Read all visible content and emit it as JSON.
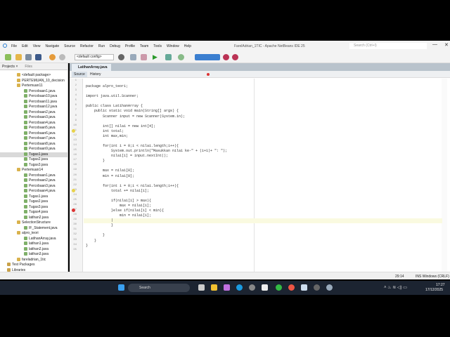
{
  "window": {
    "title": "FarelAdrian_1TIC - Apache NetBeans IDE 25",
    "search_placeholder": "Search (Ctrl+I)",
    "minimize": "—",
    "maximize": "❐",
    "close": "✕"
  },
  "menu": [
    "File",
    "Edit",
    "View",
    "Navigate",
    "Source",
    "Refactor",
    "Run",
    "Debug",
    "Profile",
    "Team",
    "Tools",
    "Window",
    "Help"
  ],
  "toolbar": {
    "config": "<default config>"
  },
  "projects_panel": {
    "tabs": [
      "Projects ×",
      "Files"
    ],
    "tree": [
      {
        "label": "<default package>",
        "level": 2,
        "type": "pkg"
      },
      {
        "label": "PERTEMUAN_10_decision",
        "level": 2,
        "type": "pkg"
      },
      {
        "label": "Pertemuan11",
        "level": 2,
        "type": "pkg"
      },
      {
        "label": "Percobaan1.java",
        "level": 3,
        "type": "java"
      },
      {
        "label": "Percobaan10.java",
        "level": 3,
        "type": "java"
      },
      {
        "label": "Percobaan11.java",
        "level": 3,
        "type": "java"
      },
      {
        "label": "Percobaan12.java",
        "level": 3,
        "type": "java"
      },
      {
        "label": "Percobaan2.java",
        "level": 3,
        "type": "java"
      },
      {
        "label": "Percobaan3.java",
        "level": 3,
        "type": "java"
      },
      {
        "label": "Percobaan4.java",
        "level": 3,
        "type": "java"
      },
      {
        "label": "Percobaan5.java",
        "level": 3,
        "type": "java"
      },
      {
        "label": "Percobaan6.java",
        "level": 3,
        "type": "java"
      },
      {
        "label": "Percobaan7.java",
        "level": 3,
        "type": "java"
      },
      {
        "label": "Percobaan8.java",
        "level": 3,
        "type": "java"
      },
      {
        "label": "Percobaan9.java",
        "level": 3,
        "type": "java"
      },
      {
        "label": "Tugas1.java",
        "level": 3,
        "type": "java",
        "selected": true
      },
      {
        "label": "Tugas2.java",
        "level": 3,
        "type": "java"
      },
      {
        "label": "Tugas3.java",
        "level": 3,
        "type": "java"
      },
      {
        "label": "Pertemuan14",
        "level": 2,
        "type": "pkg"
      },
      {
        "label": "Percobaan1.java",
        "level": 3,
        "type": "java"
      },
      {
        "label": "Percobaan2.java",
        "level": 3,
        "type": "java"
      },
      {
        "label": "Percobaan3.java",
        "level": 3,
        "type": "java"
      },
      {
        "label": "Percobaan4.java",
        "level": 3,
        "type": "java"
      },
      {
        "label": "Tugas1.java",
        "level": 3,
        "type": "java"
      },
      {
        "label": "Tugas2.java",
        "level": 3,
        "type": "java"
      },
      {
        "label": "Tugas3.java",
        "level": 3,
        "type": "java"
      },
      {
        "label": "Tugas4.java",
        "level": 3,
        "type": "java"
      },
      {
        "label": "latihan2.java",
        "level": 3,
        "type": "java"
      },
      {
        "label": "SelectionStructure",
        "level": 2,
        "type": "pkg"
      },
      {
        "label": "IF_Statement.java",
        "level": 3,
        "type": "java"
      },
      {
        "label": "alpro_teori",
        "level": 2,
        "type": "pkg"
      },
      {
        "label": "LatihanArray.java",
        "level": 3,
        "type": "java"
      },
      {
        "label": "latihan1.java",
        "level": 3,
        "type": "java"
      },
      {
        "label": "latihan2.java",
        "level": 3,
        "type": "java"
      },
      {
        "label": "latihan3.java",
        "level": 3,
        "type": "java"
      },
      {
        "label": "fareladrian_1tic",
        "level": 2,
        "type": "pkg"
      },
      {
        "label": "Test Packages",
        "level": 1,
        "type": "folder"
      },
      {
        "label": "Libraries",
        "level": 1,
        "type": "folder"
      }
    ]
  },
  "editor": {
    "tab": "LatihanArray.java",
    "source_tab": "Source",
    "history_tab": "History",
    "lines": [
      "",
      "package alpro_teori;",
      "",
      "import java.util.Scanner;",
      "",
      "public class LatihanArray {",
      "    public static void main(String[] args) {",
      "        Scanner input = new Scanner(System.in);",
      "",
      "        int[] nilai = new int[4];",
      "        int total;",
      "        int max,min;",
      "",
      "        for(int i = 0;i < nilai.length;i++){",
      "            System.out.println(\"Masukkan nilai ke-\" + (i+1)+ \": \");",
      "            nilai[i] = input.nextInt();",
      "        }",
      "",
      "        max = nilai[0];",
      "        min = nilai[0];",
      "",
      "        for(int i = 0;i < nilai.length;i++){",
      "            total += nilai[i];",
      "",
      "            if(nilai[i] > max){",
      "                max = nilai[i];",
      "            }else if(nilai[i] < min){",
      "                min = nilai[i];",
      "            |",
      "            }",
      "",
      "        }",
      "    }",
      "}",
      ""
    ]
  },
  "status": {
    "position": "29:14",
    "mode": "INS Windows (CRLF)"
  },
  "taskbar": {
    "search": "Search",
    "time": "17:27",
    "date": "17/12/2025"
  }
}
